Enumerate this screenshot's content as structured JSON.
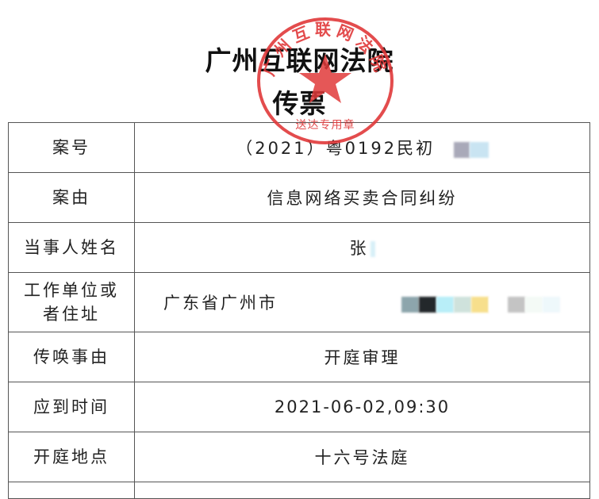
{
  "header": {
    "court_name": "广州互联网法院",
    "document_type": "传票"
  },
  "seal": {
    "arc_text": "广州互联网法院",
    "bottom_text": "送达专用章",
    "color": "#e0393a"
  },
  "rows": [
    {
      "label": "案号",
      "value": "（2021）粤0192民初"
    },
    {
      "label": "案由",
      "value": "信息网络买卖合同纠纷"
    },
    {
      "label": "当事人姓名",
      "value": "张"
    },
    {
      "label_line1": "工作单位或",
      "label_line2": "者住址",
      "value": "广东省广州市"
    },
    {
      "label": "传唤事由",
      "value": "开庭审理"
    },
    {
      "label": "应到时间",
      "value": "2021-06-02,09:30"
    },
    {
      "label": "开庭地点",
      "value": "十六号法庭"
    }
  ],
  "redaction_colors": [
    "#a9a9b9",
    "#c9e4f2",
    "#d8f0f8",
    "#8da5ac",
    "#23282b",
    "#b8eef8",
    "#cfe2dc",
    "#f7df8c",
    "#c4c4c4",
    "#f4faf6",
    "#eef8fb"
  ]
}
